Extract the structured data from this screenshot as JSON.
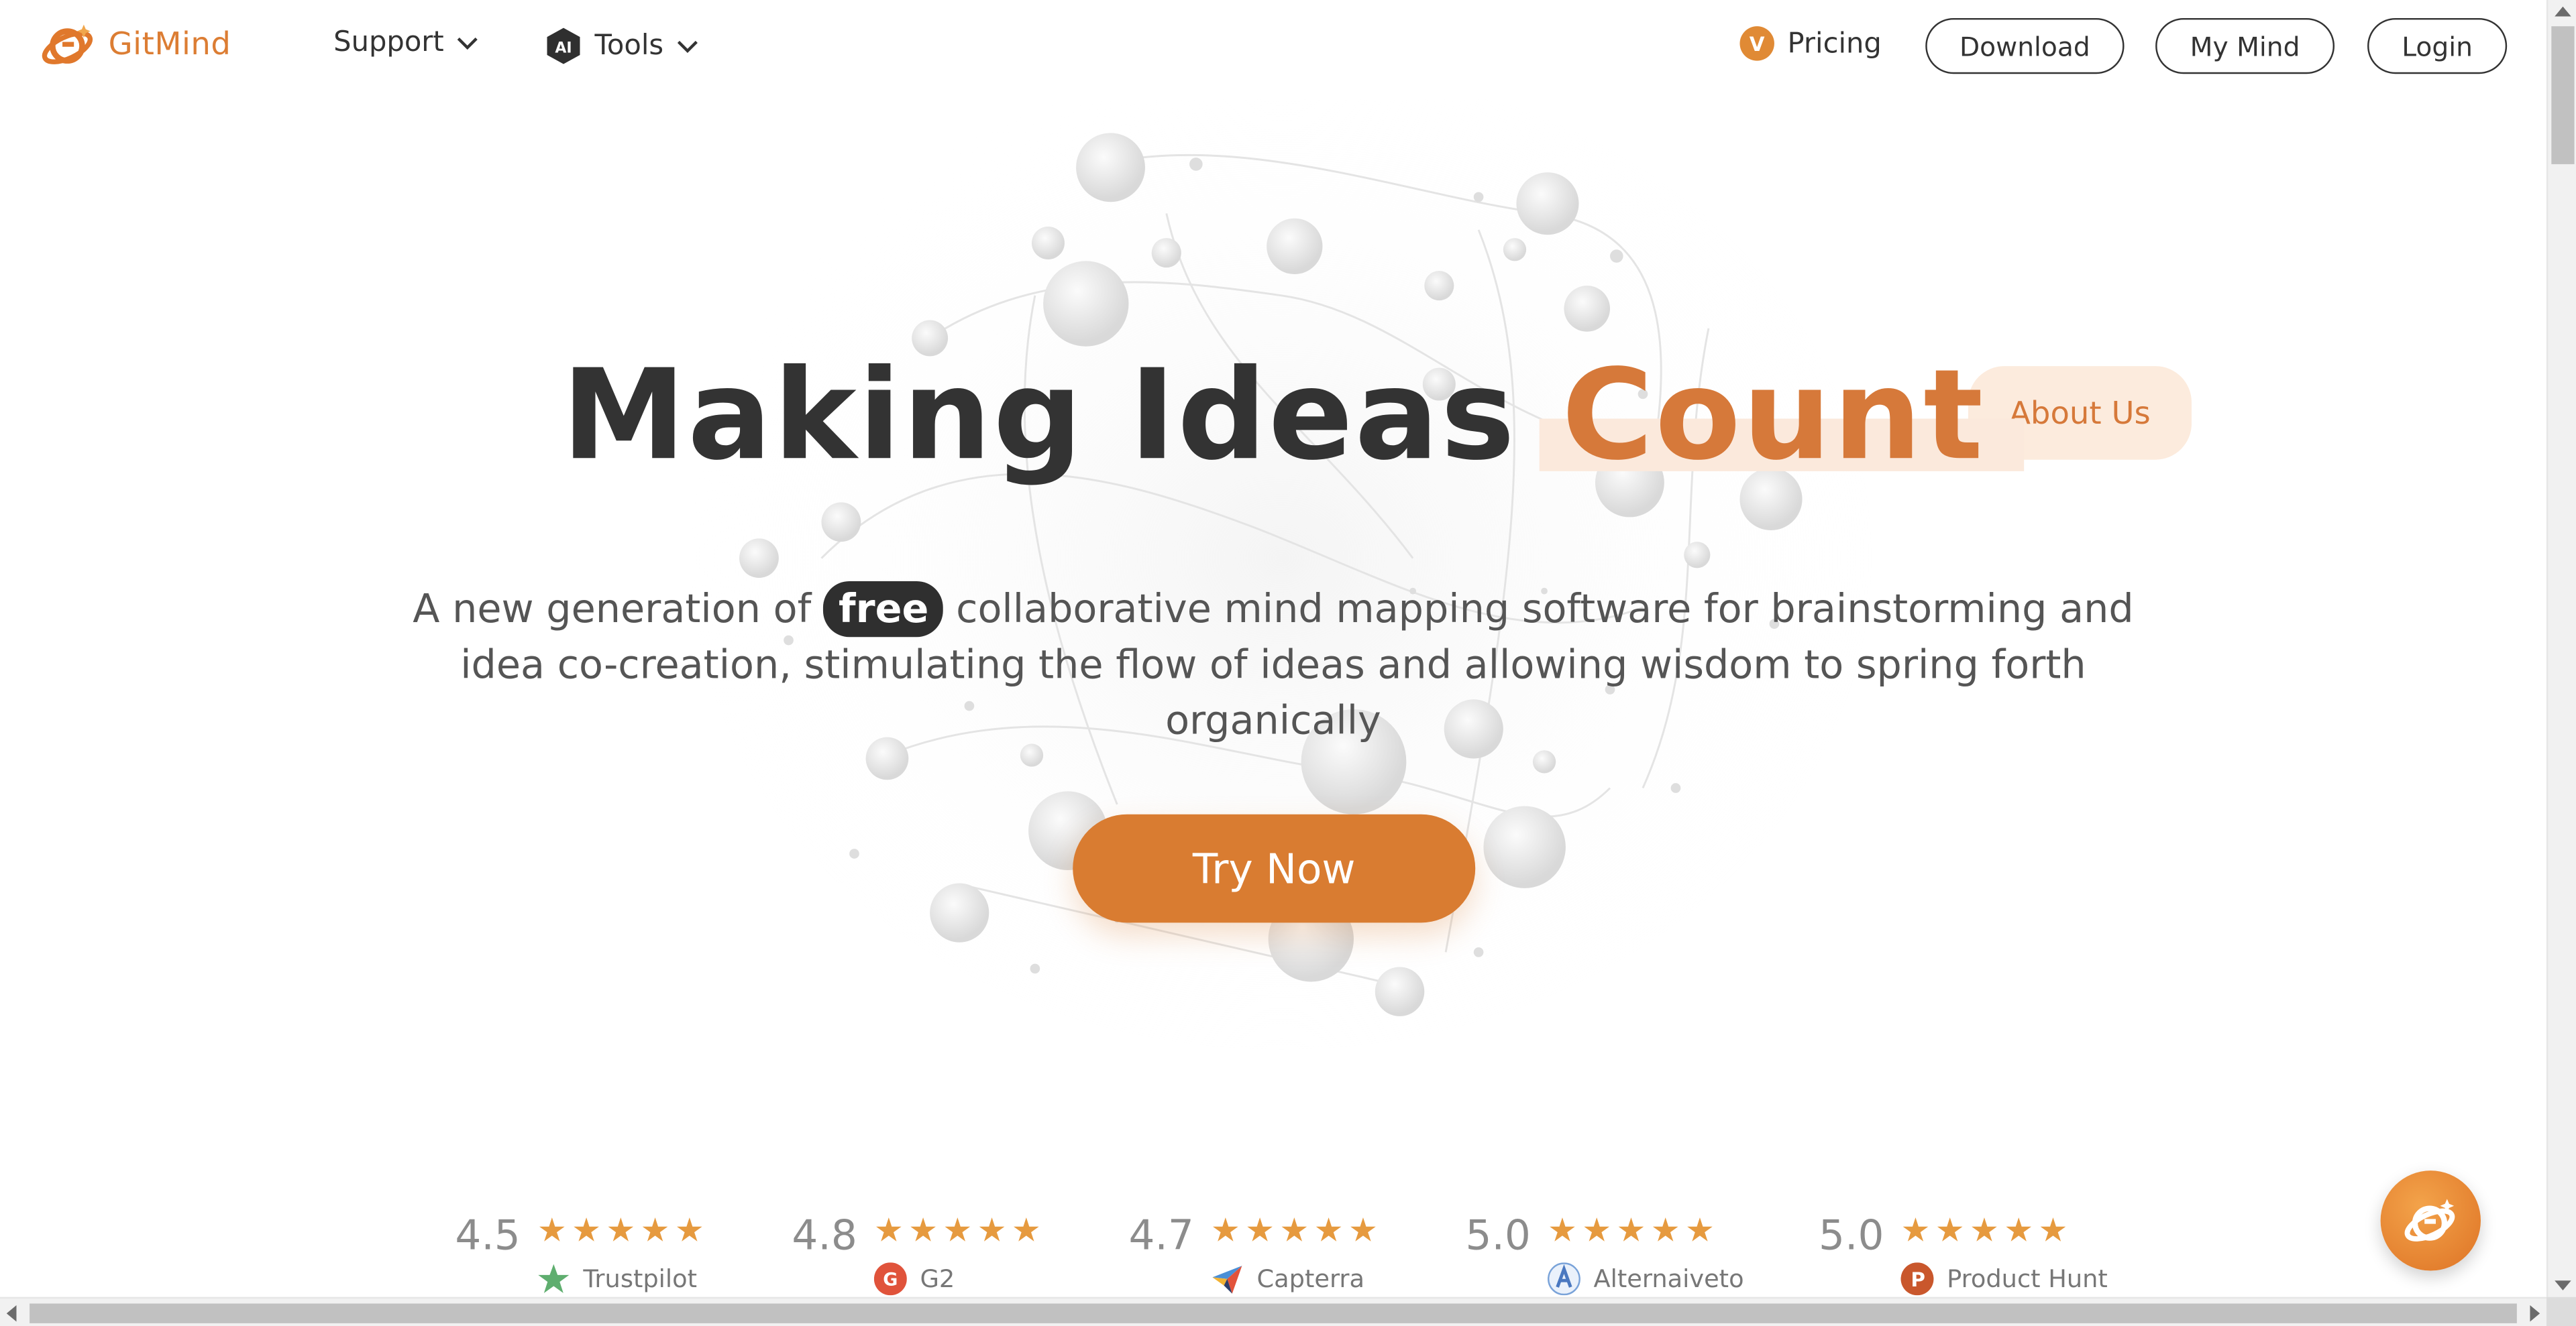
{
  "brand": {
    "name": "GitMind",
    "accent_color": "#dc7d33"
  },
  "nav": {
    "support_label": "Support",
    "ai_badge": "AI",
    "tools_label": "Tools",
    "pricing_badge": "V",
    "pricing_label": "Pricing",
    "download_label": "Download",
    "mymind_label": "My Mind",
    "login_label": "Login"
  },
  "hero": {
    "title_main": "Making Ideas",
    "title_accent": "Count",
    "about_label": "About Us",
    "subtitle_before": "A new generation of",
    "subtitle_free": "free",
    "subtitle_after": "collaborative mind mapping software for brainstorming and idea co-creation, stimulating the flow of ideas and allowing wisdom to spring forth organically",
    "cta_label": "Try Now"
  },
  "ratings": [
    {
      "score": "4.5",
      "stars": 5,
      "stars_text": "★★★★★",
      "platform": "Trustpilot",
      "icon": "trustpilot-star-icon"
    },
    {
      "score": "4.8",
      "stars": 5,
      "stars_text": "★★★★★",
      "platform": "G2",
      "icon": "g2-icon"
    },
    {
      "score": "4.7",
      "stars": 5,
      "stars_text": "★★★★★",
      "platform": "Capterra",
      "icon": "capterra-icon"
    },
    {
      "score": "5.0",
      "stars": 5,
      "stars_text": "★★★★★",
      "platform": "Alternaiveto",
      "icon": "alternativeto-icon"
    },
    {
      "score": "5.0",
      "stars": 5,
      "stars_text": "★★★★★",
      "platform": "Product Hunt",
      "icon": "producthunt-icon"
    }
  ],
  "colors": {
    "accent": "#d6793a",
    "button": "#d97c31",
    "star": "#e69a3f",
    "accent_tint": "#fcebdd"
  }
}
